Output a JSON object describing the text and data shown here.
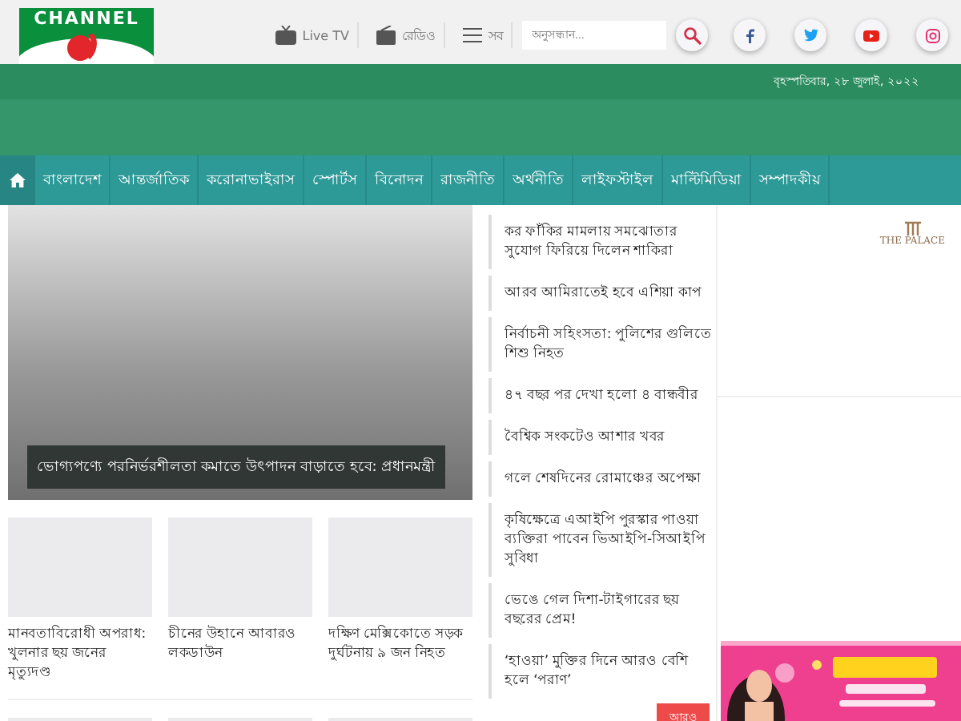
{
  "header": {
    "logo_text": "CHANNEL",
    "links": [
      {
        "kind": "tv",
        "label": "Live TV"
      },
      {
        "kind": "radio",
        "label": "রেডিও"
      },
      {
        "kind": "menu",
        "label": "সব"
      }
    ],
    "search": {
      "placeholder": "অনুসন্ধান..."
    },
    "social": [
      {
        "kind": "facebook",
        "color": "#3b5998"
      },
      {
        "kind": "twitter",
        "color": "#1da1f2"
      },
      {
        "kind": "youtube",
        "color": "#e62117"
      },
      {
        "kind": "instagram",
        "color": "#e1306c"
      }
    ]
  },
  "date": "বৃহস্পতিবার, ২৮ জুলাই, ২০২২",
  "nav": [
    {
      "label": "বাংলাদেশ",
      "selected": false
    },
    {
      "label": "আন্তর্জাতিক",
      "selected": false
    },
    {
      "label": "করোনাভাইরাস",
      "selected": false
    },
    {
      "label": "স্পোর্টস",
      "selected": false
    },
    {
      "label": "বিনোদন",
      "selected": false
    },
    {
      "label": "রাজনীতি",
      "selected": false
    },
    {
      "label": "অর্থনীতি",
      "selected": false
    },
    {
      "label": "লাইফস্টাইল",
      "selected": false
    },
    {
      "label": "মাল্টিমিডিয়া",
      "selected": false
    },
    {
      "label": "সম্পাদকীয়",
      "selected": false
    }
  ],
  "lead": {
    "caption": "ভোগ্যপণ্যে পরনির্ভরশীলতা কমাতে উৎপাদন বাড়াতে হবে: প্রধানমন্ত্রী"
  },
  "cards": [
    {
      "title": "মানবতাবিরোধী অপরাধ: খুলনার ছয় জনের মৃত্যুদণ্ড"
    },
    {
      "title": "চীনের উহানে আবারও লকডাউন"
    },
    {
      "title": "দক্ষিণ মেক্সিকোতে সড়ক দুর্ঘটনায় ৯ জন নিহত"
    }
  ],
  "latest": [
    "কর ফাঁকির মামলায় সমঝোতার সুযোগ ফিরিয়ে দিলেন শাকিরা",
    "আরব আমিরাতেই হবে এশিয়া কাপ",
    "নির্বাচনী সহিংসতা: পুলিশের গুলিতে শিশু নিহত",
    "৪৭ বছর পর দেখা হলো ৪ বান্ধবীর",
    "বৈশ্বিক সংকটেও আশার খবর",
    "গলে শেষদিনের রোমাঞ্চের অপেক্ষা",
    "কৃষিক্ষেত্রে এআইপি পুরস্কার পাওয়া ব্যক্তিরা পাবেন ভিআইপি-সিআইপি সুবিধা",
    "ভেঙে গেল দিশা-টাইগারের ছয় বছরের প্রেম!",
    "‘হাওয়া’ মুক্তির দিনে আরও বেশি হলে ‘পরাণ’"
  ],
  "more_button": "আরও",
  "ads": [
    {
      "kind": "logo",
      "label": "THE PALACE"
    },
    {
      "kind": "picture"
    }
  ]
}
